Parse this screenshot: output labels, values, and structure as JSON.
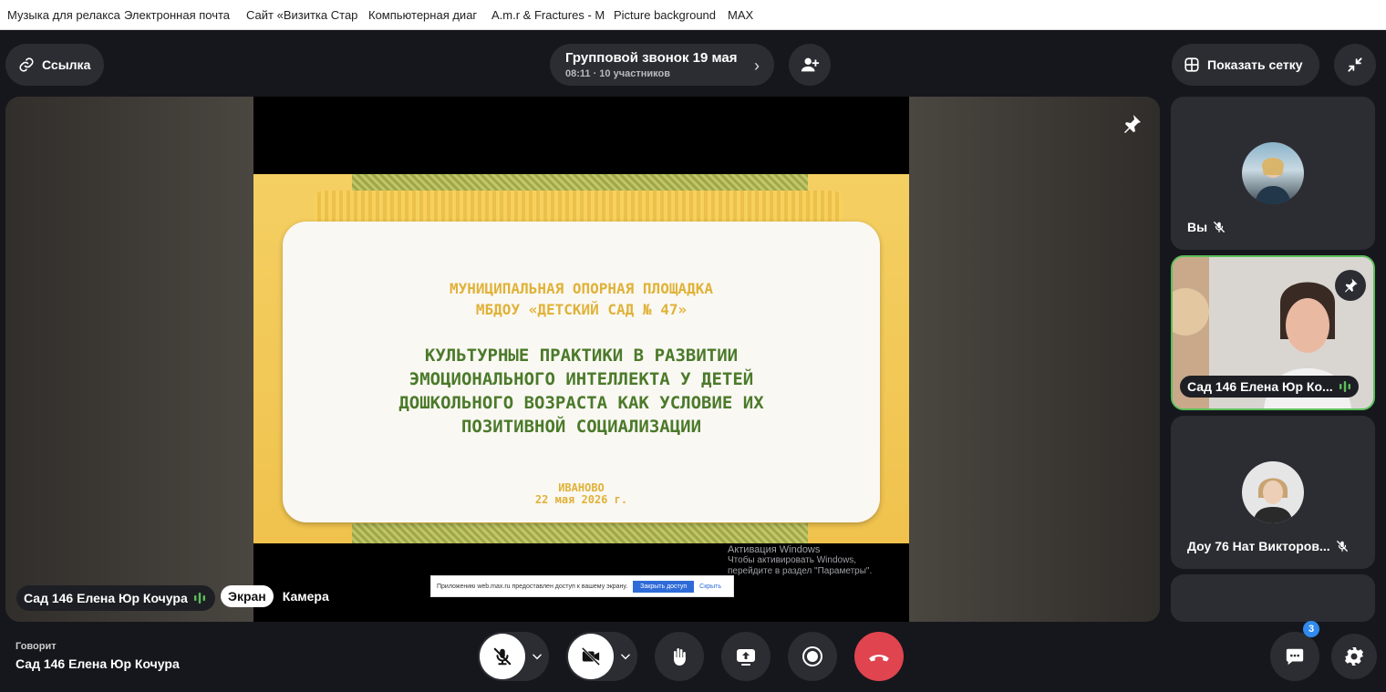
{
  "bookmarks": [
    "Музыка для релакса",
    "Электронная почта",
    "Сайт «Визитка Стар",
    "Компьютерная диаг",
    "A.m.r & Fractures - M",
    "Picture background",
    "MAX"
  ],
  "header": {
    "link_label": "Ссылка",
    "call_title": "Групповой звонок 19 мая",
    "call_subtitle": "08:11 · 10 участников",
    "grid_label": "Показать сетку"
  },
  "slide": {
    "org_line1": "МУНИЦИПАЛЬНАЯ ОПОРНАЯ ПЛОЩАДКА",
    "org_line2": "МБДОУ «ДЕТСКИЙ САД № 47»",
    "title_line1": "КУЛЬТУРНЫЕ ПРАКТИКИ В РАЗВИТИИ",
    "title_line2": "ЭМОЦИОНАЛЬНОГО ИНТЕЛЛЕКТА У ДЕТЕЙ",
    "title_line3": "ДОШКОЛЬНОГО ВОЗРАСТА КАК УСЛОВИЕ ИХ",
    "title_line4": "ПОЗИТИВНОЙ СОЦИАЛИЗАЦИИ",
    "city": "ИВАНОВО",
    "date": "22 мая 2026 г."
  },
  "watermark": {
    "heading": "Активация Windows",
    "text": "Чтобы активировать Windows, перейдите в раздел \"Параметры\"."
  },
  "share_notice": {
    "text": "Приложению web.max.ru предоставлен доступ к вашему экрану.",
    "close_label": "Закрыть доступ",
    "hide_label": "Скрыть"
  },
  "stage": {
    "speaker": "Сад 146 Елена Юр Кочура",
    "tab_screen": "Экран",
    "tab_camera": "Камера"
  },
  "participants": [
    {
      "name": "Вы",
      "muted": true
    },
    {
      "name": "Сад 146 Елена Юр Ко...",
      "muted": false
    },
    {
      "name": "Доу 76 Нат Викторов...",
      "muted": true
    }
  ],
  "bottom": {
    "speaking_label": "Говорит",
    "speaking_name": "Сад 146 Елена Юр Кочура",
    "chat_badge": "3"
  },
  "colors": {
    "accent_green": "#5cbf5a",
    "end_call": "#e0444f",
    "badge": "#2f8bf0"
  }
}
